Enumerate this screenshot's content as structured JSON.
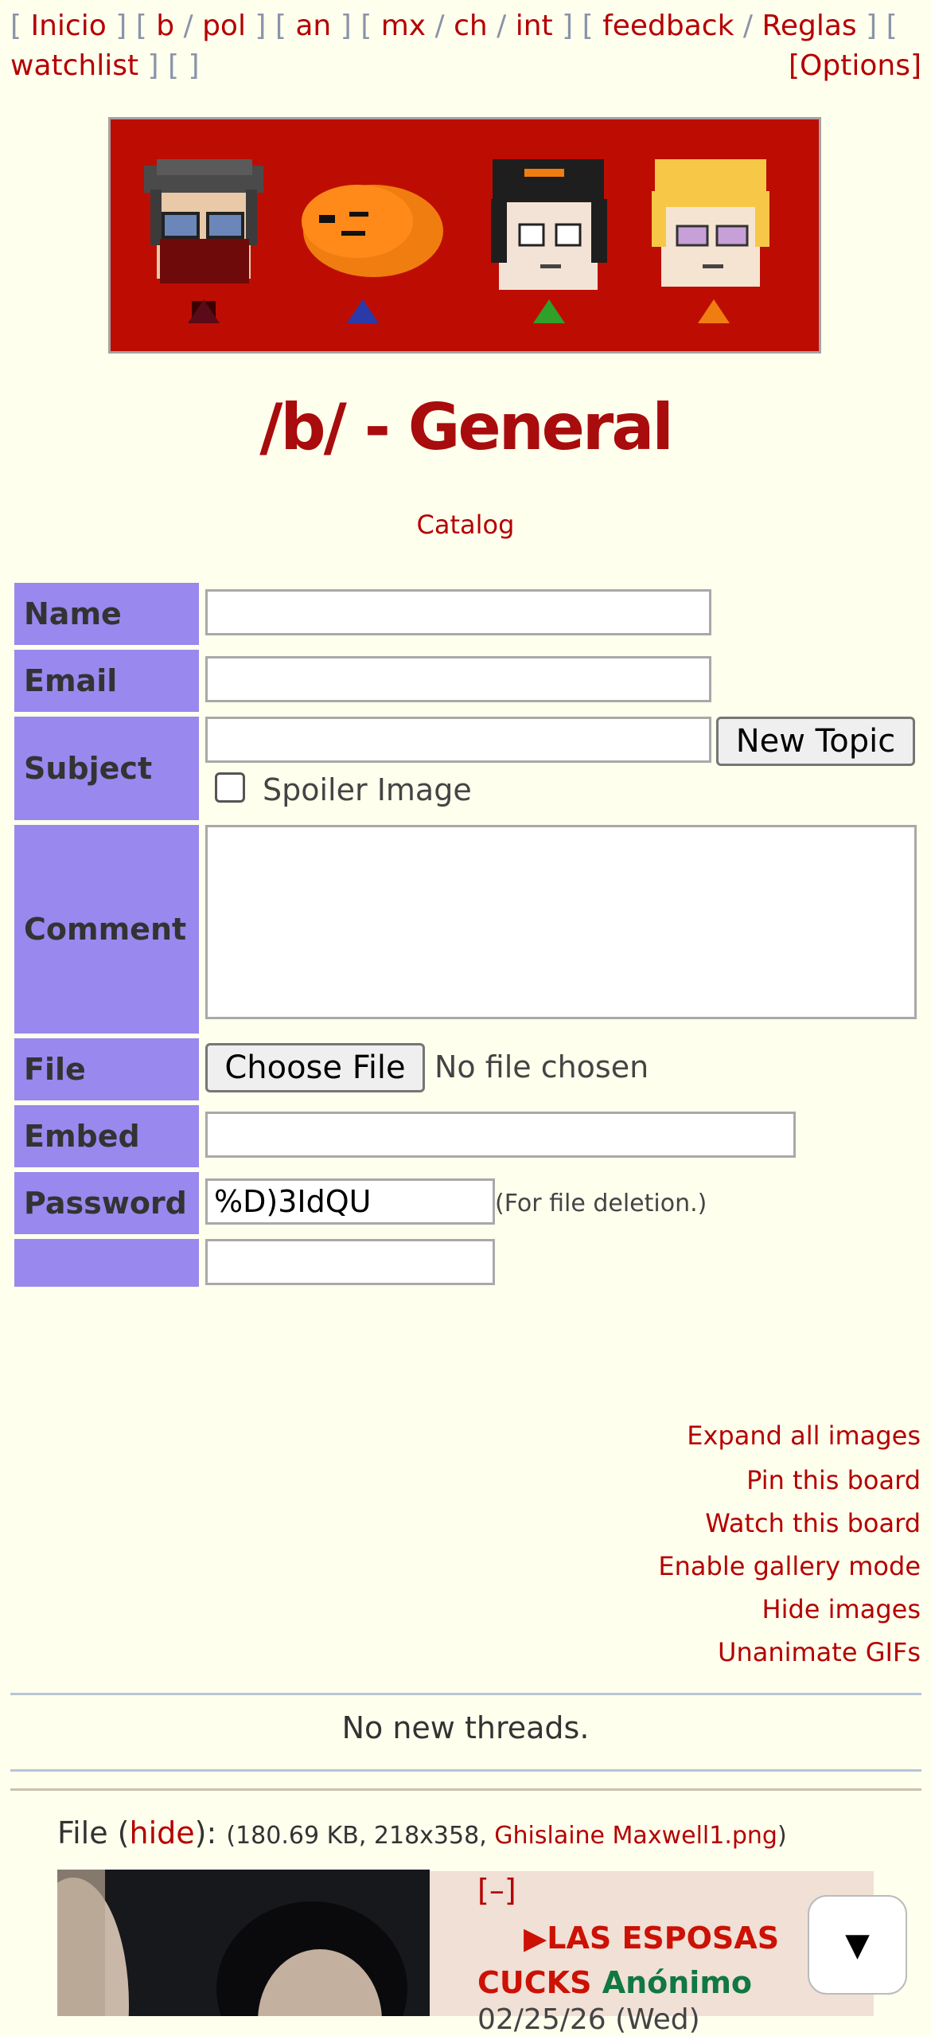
{
  "nav": {
    "inicio": "Inicio",
    "b": "b",
    "pol": "pol",
    "an": "an",
    "mx": "mx",
    "ch": "ch",
    "int": "int",
    "feedback": "feedback",
    "reglas": "Reglas",
    "watchlist": "watchlist",
    "options": "[Options]"
  },
  "board": {
    "title": "/b/ - General",
    "catalog": "Catalog"
  },
  "form": {
    "name_label": "Name",
    "email_label": "Email",
    "subject_label": "Subject",
    "comment_label": "Comment",
    "file_label": "File",
    "embed_label": "Embed",
    "password_label": "Password",
    "new_topic": "New Topic",
    "spoiler": "Spoiler Image",
    "choose_file": "Choose File",
    "no_file": "No file chosen",
    "password_value": "%D)3IdQU",
    "password_note": "(For file deletion.)"
  },
  "options": {
    "expand": "Expand all images",
    "pin": "Pin this board",
    "watch": "Watch this board",
    "gallery": "Enable gallery mode",
    "hide": "Hide images",
    "unanimate": "Unanimate GIFs"
  },
  "threads": {
    "status": "No new threads."
  },
  "post": {
    "file_prefix": "File (",
    "hide": "hide",
    "file_mid": "): ",
    "file_meta": "(180.69 KB, 218x358, ",
    "filename": "Ghislaine Maxwell1.png",
    "file_end": ")",
    "collapse": "[–]",
    "subject": "▶LAS ESPOSAS CUCKS",
    "author": "Anónimo",
    "date": "02/25/26 (Wed)"
  },
  "scroll_icon": "▼",
  "colors": {
    "background": "#ffffee",
    "link": "#b40000",
    "label_bg": "#9988ee",
    "banner": "#bd0d03",
    "post_bg": "#f0e0d6",
    "author": "#117743"
  }
}
